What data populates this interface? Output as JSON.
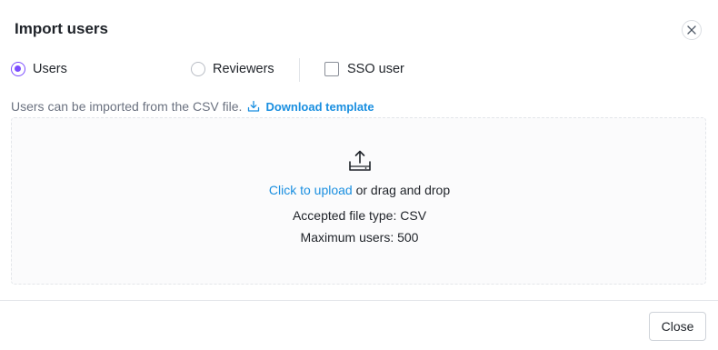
{
  "dialog": {
    "title": "Import users",
    "close_icon": "close-icon"
  },
  "options": {
    "radios": [
      {
        "label": "Users",
        "checked": true
      },
      {
        "label": "Reviewers",
        "checked": false
      }
    ],
    "checkbox": {
      "label": "SSO user",
      "checked": false
    }
  },
  "info": {
    "text": "Users can be imported from the CSV file.",
    "download_link": "Download template",
    "download_icon": "download-icon"
  },
  "dropzone": {
    "icon": "upload-icon",
    "click_text": "Click to upload",
    "drag_text": " or drag and drop",
    "accepted": "Accepted file type: CSV",
    "max_users": "Maximum users: 500"
  },
  "footer": {
    "close_label": "Close"
  },
  "colors": {
    "accent_purple": "#7c4dff",
    "link_blue": "#1a8fe0"
  }
}
